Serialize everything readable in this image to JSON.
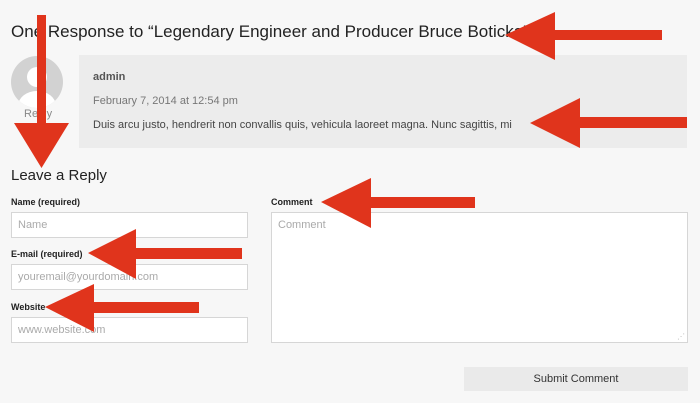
{
  "comments": {
    "heading": "One Response to “Legendary Engineer and Producer Bruce Boticka”",
    "reply_link": "Reply",
    "items": [
      {
        "author": "admin",
        "date": "February 7, 2014 at 12:54 pm",
        "text": "Duis arcu justo, hendrerit non convallis quis, vehicula laoreet magna. Nunc sagittis, mi"
      }
    ]
  },
  "reply_form": {
    "title": "Leave a Reply",
    "name_label": "Name (required)",
    "name_placeholder": "Name",
    "email_label": "E-mail (required)",
    "email_placeholder": "youremail@yourdomain.com",
    "website_label": "Website",
    "website_placeholder": "www.website.com",
    "comment_label": "Comment",
    "comment_placeholder": "Comment",
    "submit_label": "Submit Comment"
  },
  "colors": {
    "annotation_arrow": "#e0341c",
    "page_background": "#f7f7f7",
    "comment_background": "#ececec"
  }
}
